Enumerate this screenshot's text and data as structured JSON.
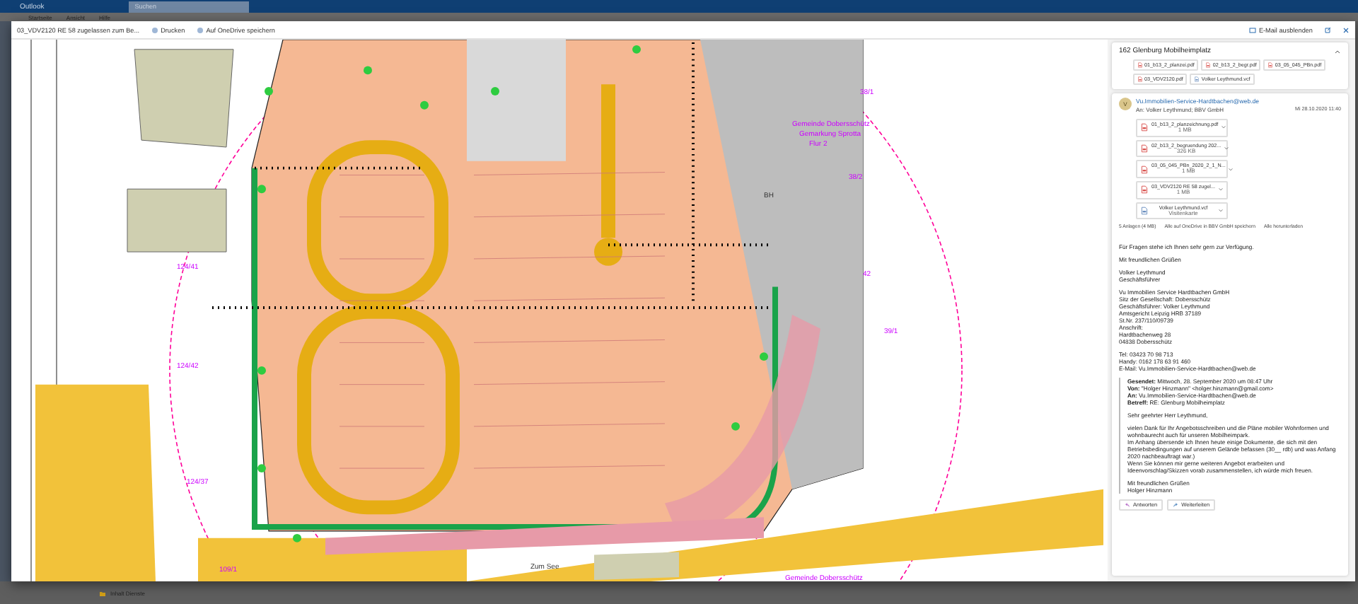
{
  "app": {
    "title": "Outlook",
    "search_placeholder": "Suchen"
  },
  "menu": [
    "Startseite",
    "Ansicht",
    "Hilfe"
  ],
  "viewer": {
    "file_name": "03_VDV2120 RE 58 zugelassen zum Be...",
    "actions": [
      "Drucken",
      "Auf OneDrive speichern"
    ],
    "hide_mail": "E-Mail ausblenden"
  },
  "map": {
    "labels": [
      "124/41",
      "124/42",
      "124/37",
      "109/1",
      "38/1",
      "38/2",
      "42",
      "39/1",
      "Gemeinde Dobersschütz",
      "Gemarkung Sprotta",
      "Flur 2",
      "BH",
      "Zum See",
      "Gemeinde Dobersschütz"
    ]
  },
  "mail": {
    "subject": "162 Glenburg Mobilheimplatz",
    "expanded": true,
    "thread_attachments": [
      {
        "name": "01_b13_2_planzei.pdf",
        "kind": "pdf"
      },
      {
        "name": "02_b13_2_begr.pdf",
        "kind": "pdf"
      },
      {
        "name": "03_05_045_PBn.pdf",
        "kind": "pdf"
      },
      {
        "name": "03_VDV2120.pdf",
        "kind": "pdf"
      },
      {
        "name": "Volker Leythmund.vcf",
        "kind": "vcf"
      }
    ],
    "message": {
      "sender_initial": "V",
      "sender": "Vu.Immobilien-Service-Hardtbachen@web.de",
      "to": "An: Volker Leythmund; BBV GmbH",
      "date": "Mi 28.10.2020 11:40",
      "attachments": [
        {
          "name": "01_b13_2_planzeichnung.pdf",
          "size": "1 MB",
          "kind": "pdf"
        },
        {
          "name": "02_b13_2_begruendung 202...",
          "size": "326 KB",
          "kind": "pdf"
        },
        {
          "name": "03_05_045_PBn_2020_2_1_N...",
          "size": "1 MB",
          "kind": "pdf"
        },
        {
          "name": "03_VDV2120 RE 58 zugel...",
          "size": "1 MB",
          "kind": "pdf"
        },
        {
          "name": "Volker Leythmund.vcf",
          "size": "Visitenkarte",
          "kind": "vcf"
        }
      ],
      "summary": [
        "5 Anlagen (4 MB)",
        "Alle auf OneDrive in BBV GmbH speichern",
        "Alle herunterladen"
      ],
      "body": [
        [
          "Für Fragen stehe ich Ihnen sehr gern zur Verfügung."
        ],
        [
          "Mit freundlichen Grüßen"
        ],
        [
          "Volker Leythmund",
          "Geschäftsführer"
        ],
        [
          "Vu Immobilien Service Hardtbachen GmbH",
          "Sitz der Gesellschaft: Dobersschütz",
          "Geschäftsführer: Volker Leythmund",
          "Amtsgericht Leipzig HRB 37189",
          "St.Nr. 237/110/09739",
          "Anschrift:",
          "Hardtbachenweg 28",
          "04838 Dobersschütz"
        ],
        [
          "Tel: 03423 70 98 713",
          "Handy: 0162 178 63 91 460",
          "E-Mail: Vu.Immobilien-Service-Hardtbachen@web.de"
        ]
      ],
      "quote": [
        [
          "**Gesendet:** Mittwoch, 28. September 2020 um 08:47 Uhr",
          "**Von:** \"Holger Hinzmann\" <holger.hinzmann@gmail.com>",
          "**An:** Vu.Immobilien-Service-Hardtbachen@web.de",
          "**Betreff:** RE: Glenburg Mobilheimplatz"
        ],
        [
          "Sehr geehrter Herr Leythmund,"
        ],
        [
          "vielen Dank für Ihr Angebotsschreiben und die Pläne mobiler Wohnformen und wohnbaurecht auch für unseren Mobilheimpark.",
          "Im Anhang übersende ich Ihnen heute einige Dokumente, die sich mit den Betriebsbedingungen auf unserem Gelände befassen (30__ rdb) und was Anfang 2020 nachbeauftragt war.)",
          "Wenn Sie können mir gerne weiteren Angebot erarbeiten und Ideenvorschlag/Skizzen vorab zusammenstellen, ich würde mich freuen."
        ],
        [
          "Mit freundlichen Grüßen",
          "Holger Hinzmann"
        ]
      ],
      "buttons": [
        {
          "label": "Antworten",
          "kind": "reply"
        },
        {
          "label": "Weiterleiten",
          "kind": "forward"
        }
      ]
    }
  },
  "taskbar": {
    "item": "Inhalt Dienste"
  }
}
